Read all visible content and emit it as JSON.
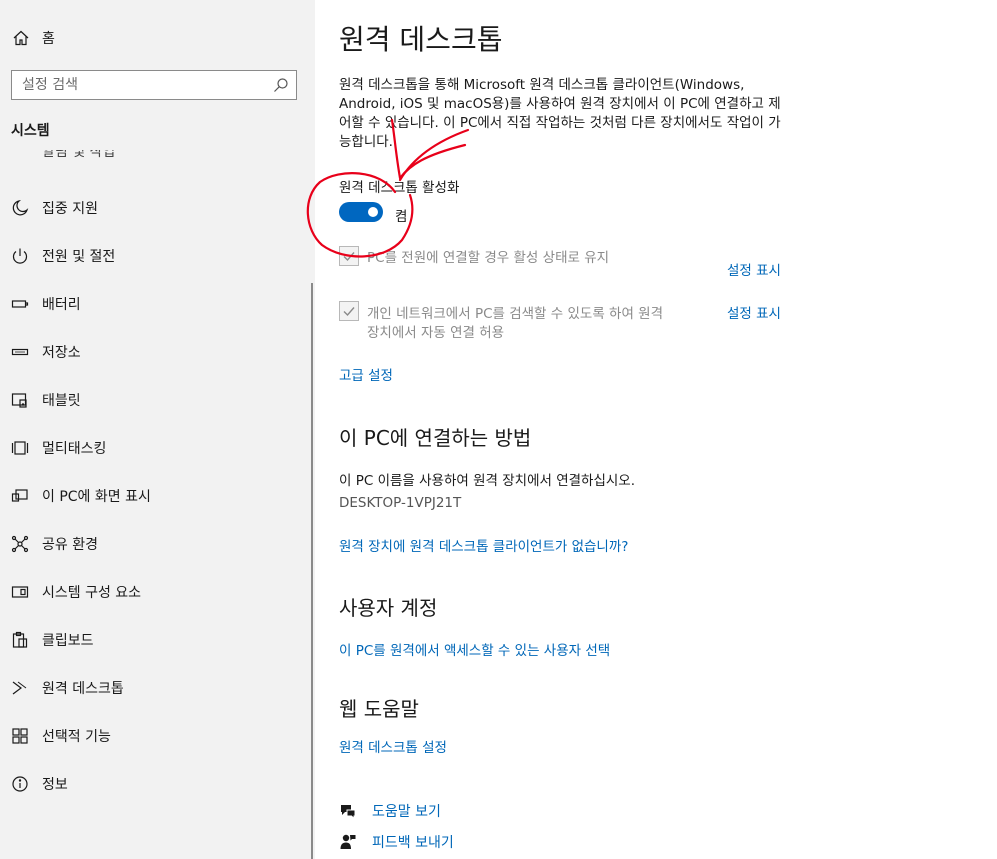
{
  "sidebar": {
    "home_label": "홈",
    "search_placeholder": "설정 검색",
    "section_title": "시스템",
    "cut_item_label": "알림 및 작업",
    "items": [
      {
        "label": "집중 지원",
        "icon": "moon-icon"
      },
      {
        "label": "전원 및 절전",
        "icon": "power-icon"
      },
      {
        "label": "배터리",
        "icon": "battery-icon"
      },
      {
        "label": "저장소",
        "icon": "storage-icon"
      },
      {
        "label": "태블릿",
        "icon": "tablet-icon"
      },
      {
        "label": "멀티태스킹",
        "icon": "multitasking-icon"
      },
      {
        "label": "이 PC에 화면 표시",
        "icon": "project-icon"
      },
      {
        "label": "공유 환경",
        "icon": "share-icon"
      },
      {
        "label": "시스템 구성 요소",
        "icon": "components-icon"
      },
      {
        "label": "클립보드",
        "icon": "clipboard-icon"
      },
      {
        "label": "원격 데스크톱",
        "icon": "remote-desktop-icon"
      },
      {
        "label": "선택적 기능",
        "icon": "optional-features-icon"
      },
      {
        "label": "정보",
        "icon": "info-icon"
      }
    ]
  },
  "main": {
    "title": "원격 데스크톱",
    "description": "원격 데스크톱을 통해 Microsoft 원격 데스크톱 클라이언트(Windows, Android, iOS 및 macOS용)를 사용하여 원격 장치에서 이 PC에 연결하고 제어할 수 있습니다. 이 PC에서 직접 작업하는 것처럼 다른 장치에서도 작업이 가능합니다.",
    "enable_label": "원격 데스크톱 활성화",
    "toggle_state": "켬",
    "checkbox1_label": "PC를 전원에 연결할 경우 활성 상태로 유지",
    "checkbox1_link": "설정 표시",
    "checkbox2_label_line1": "개인 네트워크에서 PC를 검색할 수 있도록 하여 원격",
    "checkbox2_label_line2": "장치에서 자동 연결 허용",
    "checkbox2_link": "설정 표시",
    "advanced_link": "고급 설정",
    "connect_heading": "이 PC에 연결하는 방법",
    "connect_text": "이 PC 이름을 사용하여 원격 장치에서 연결하십시오.",
    "pc_name": "DESKTOP-1VPJ21T",
    "no_client_link": "원격 장치에 원격 데스크톱 클라이언트가 없습니까?",
    "accounts_heading": "사용자 계정",
    "accounts_link": "이 PC를 원격에서 액세스할 수 있는 사용자 선택",
    "web_help_heading": "웹 도움말",
    "web_help_link": "원격 데스크톱 설정",
    "help_link": "도움말 보기",
    "feedback_link": "피드백 보내기"
  },
  "colors": {
    "accent": "#0067c0",
    "link": "#0067b8",
    "annotation": "#e8001a",
    "sidebar_bg": "#f2f2f2"
  }
}
